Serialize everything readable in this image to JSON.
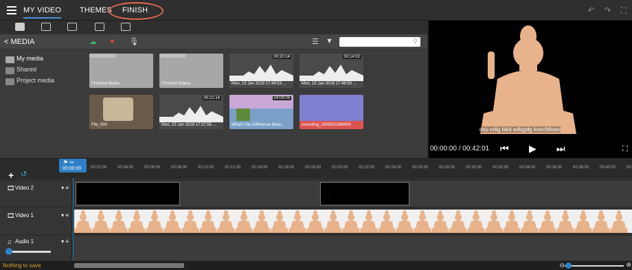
{
  "menu": {
    "tabs": [
      {
        "label": "MY VIDEO",
        "active": true
      },
      {
        "label": "THEMES",
        "active": false
      },
      {
        "label": "FINISH",
        "active": false,
        "highlighted": true
      }
    ],
    "right_icons": [
      "undo-icon",
      "redo-icon",
      "fullscreen-icon"
    ]
  },
  "media": {
    "title": "MEDIA",
    "tool_icons": [
      "media-tab-icon",
      "image-tab-icon",
      "text-tab-icon",
      "transition-tab-icon",
      "download-tab-icon"
    ],
    "actions": [
      "upload-cloud-icon",
      "record-icon",
      "microphone-icon"
    ],
    "view_icons": [
      "list-view-icon",
      "filter-icon",
      "sort-icon"
    ],
    "search_placeholder": ""
  },
  "sidebar": {
    "items": [
      {
        "label": "My media",
        "active": true
      },
      {
        "label": "Shared",
        "active": false
      },
      {
        "label": "Project media",
        "active": false
      }
    ]
  },
  "tiles": [
    {
      "kind": "folder",
      "caption": "Finished Media",
      "duration": ""
    },
    {
      "kind": "folder",
      "caption": "Finished Videos",
      "duration": ""
    },
    {
      "kind": "audio",
      "caption": "Mon, 15 Jan 2018 17:49:53 ...",
      "duration": "00:20:14"
    },
    {
      "kind": "audio",
      "caption": "Mon, 15 Jan 2018 17:48:50 ...",
      "duration": "00:14:02"
    },
    {
      "kind": "video",
      "caption": "File_000",
      "duration": ""
    },
    {
      "kind": "audio",
      "caption": "Mon, 15 Jan 2018 17:37:55 ...",
      "duration": "00:21:14"
    },
    {
      "kind": "video",
      "caption": "What's the Difference Betw...",
      "duration": "04:08:09"
    },
    {
      "kind": "recording",
      "caption": "recording_1509031368000",
      "duration": ""
    }
  ],
  "preview": {
    "subtitle": "dsu edig lskd sdkjgdg ksecfdkasc",
    "timecode": "00:00:00 / 00:42:01",
    "colors": {
      "figure": "#e8b38a",
      "background": "#000000"
    }
  },
  "timeline": {
    "playhead_time": "00:00:00",
    "ticks": [
      "00:02:00",
      "00:04:00",
      "00:06:00",
      "00:08:00",
      "00:10:00",
      "00:12:00",
      "00:14:00",
      "00:16:00",
      "00:18:00",
      "00:20:00",
      "00:22:00",
      "00:24:00",
      "00:26:00",
      "00:28:00",
      "00:30:00",
      "00:32:00",
      "00:34:00",
      "00:36:00",
      "00:38:00",
      "00:40:00",
      "00:"
    ],
    "tracks": [
      {
        "name": "Video 2",
        "icon": "film-icon"
      },
      {
        "name": "Video 1",
        "icon": "film-icon"
      },
      {
        "name": "Audio 1",
        "icon": "music-icon"
      }
    ]
  },
  "status": {
    "text": "Nothing to save",
    "zoom_label": "⊖"
  }
}
